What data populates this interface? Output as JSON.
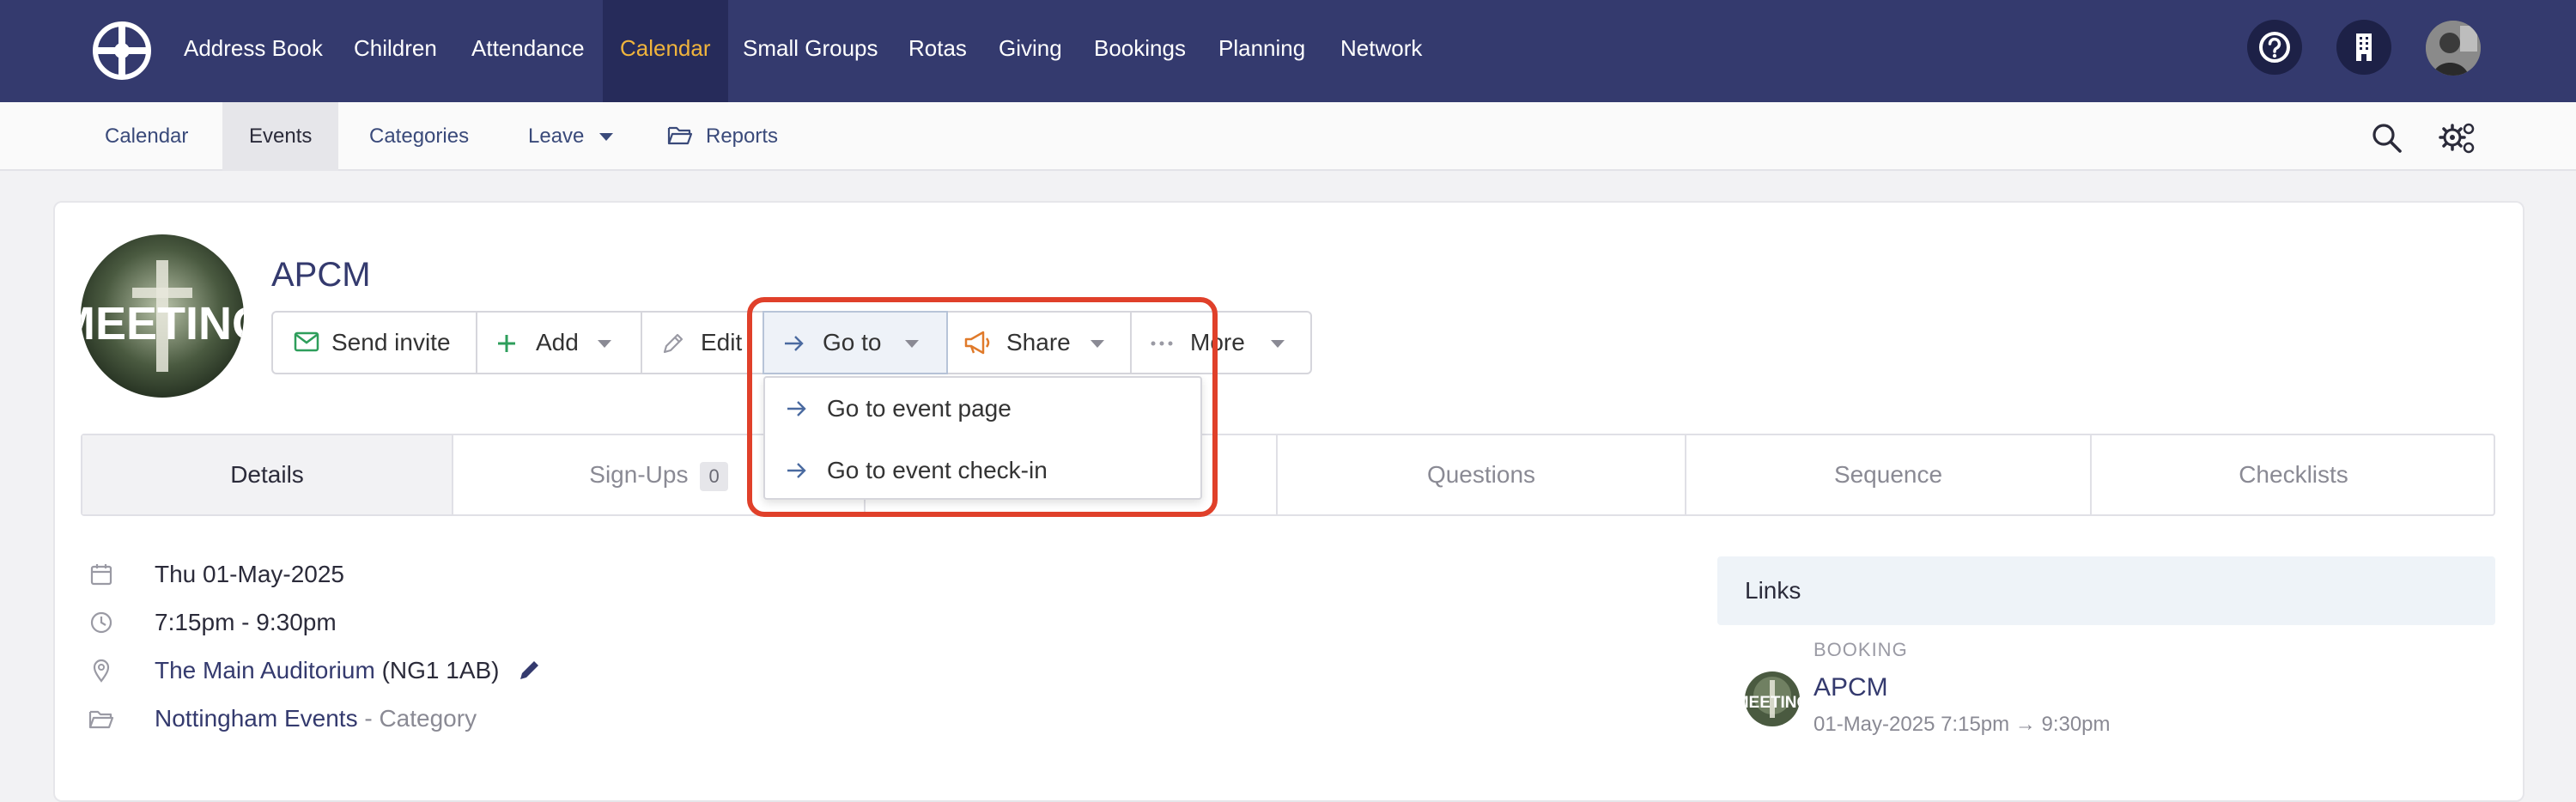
{
  "topnav": {
    "items": [
      {
        "label": "Address Book"
      },
      {
        "label": "Children"
      },
      {
        "label": "Attendance"
      },
      {
        "label": "Calendar",
        "active": true
      },
      {
        "label": "Small Groups"
      },
      {
        "label": "Rotas"
      },
      {
        "label": "Giving"
      },
      {
        "label": "Bookings"
      },
      {
        "label": "Planning"
      },
      {
        "label": "Network"
      }
    ],
    "active_color": "#f0b43c",
    "bar_color": "#343a6e"
  },
  "subnav": {
    "items": [
      {
        "label": "Calendar"
      },
      {
        "label": "Events",
        "active": true
      },
      {
        "label": "Categories"
      },
      {
        "label": "Leave"
      },
      {
        "label": "Reports"
      }
    ]
  },
  "event": {
    "title": "APCM",
    "image_text": "MEETING"
  },
  "actions": {
    "send_invite": "Send invite",
    "add": "Add",
    "edit": "Edit",
    "goto": "Go to",
    "share": "Share",
    "more": "More"
  },
  "goto_menu": {
    "items": [
      {
        "label": "Go to event page"
      },
      {
        "label": "Go to event check-in"
      }
    ]
  },
  "tabs": [
    {
      "label": "Details",
      "active": true
    },
    {
      "label": "Sign-Ups",
      "count": "0"
    },
    {
      "label": ""
    },
    {
      "label": "Questions"
    },
    {
      "label": "Sequence"
    },
    {
      "label": "Checklists"
    }
  ],
  "details": {
    "date": "Thu 01-May-2025",
    "time": "7:15pm - 9:30pm",
    "location_name": "The Main Auditorium",
    "location_postcode": "(NG1 1AB)",
    "category_name": "Nottingham Events",
    "category_suffix": "- Category"
  },
  "links": {
    "heading": "Links",
    "booking_label": "BOOKING",
    "booking_title": "APCM",
    "booking_date": "01-May-2025 7:15pm → 9:30pm"
  },
  "colors": {
    "accent_link": "#343a6e",
    "highlight": "#e0402a",
    "send_icon": "#2e9e5b",
    "share_icon": "#e07a2a"
  }
}
